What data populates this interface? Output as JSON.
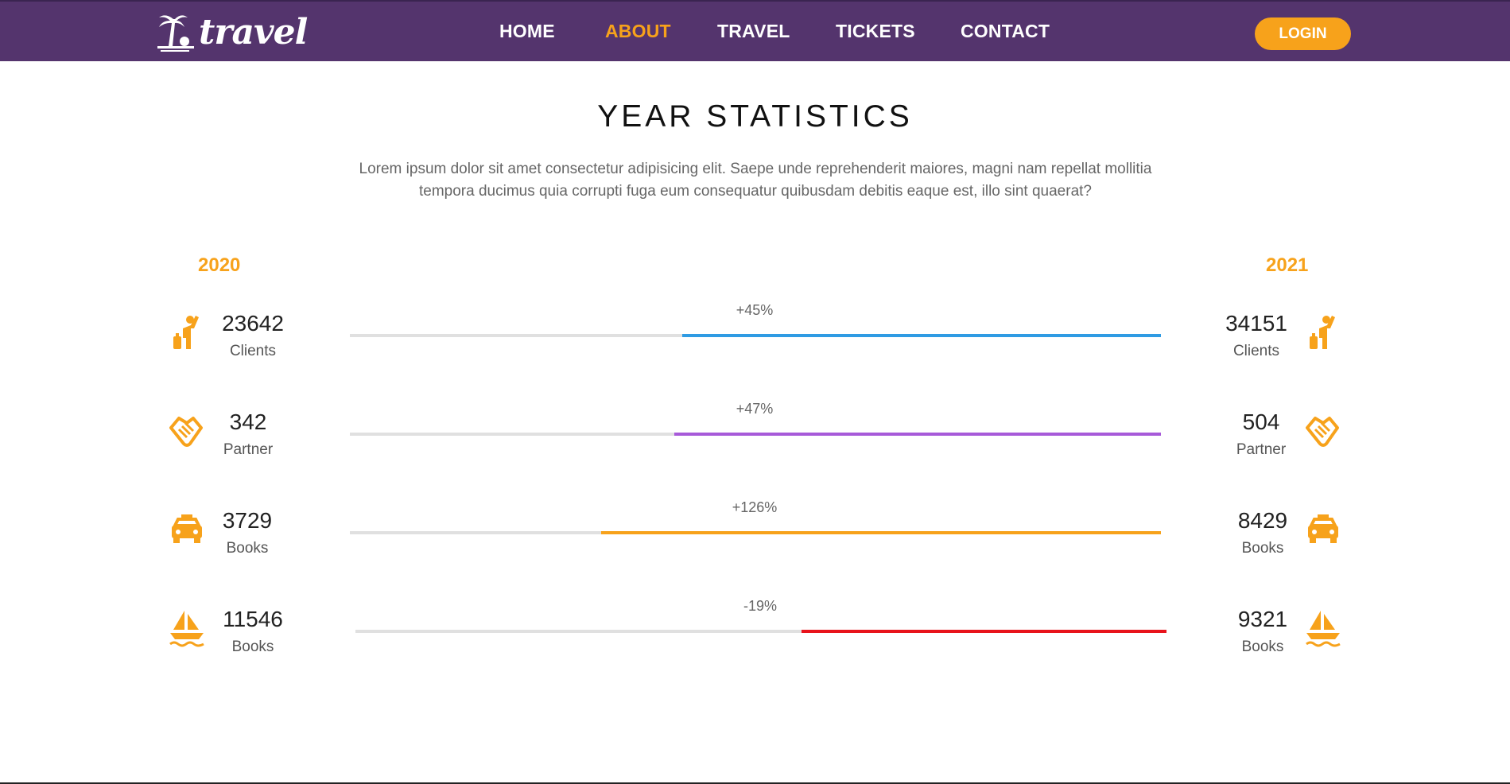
{
  "header": {
    "logo_text": "travel",
    "nav": [
      {
        "label": "HOME",
        "active": false
      },
      {
        "label": "ABOUT",
        "active": true
      },
      {
        "label": "TRAVEL",
        "active": false
      },
      {
        "label": "TICKETS",
        "active": false
      },
      {
        "label": "CONTACT",
        "active": false
      }
    ],
    "login_label": "LOGIN"
  },
  "section": {
    "title": "YEAR STATISTICS",
    "description_line1": "Lorem ipsum dolor sit amet consectetur adipisicing elit. Saepe unde reprehenderit maiores, magni nam repellat mollitia",
    "description_line2": "tempora ducimus quia corrupti fuga eum consequatur quibusdam debitis eaque est, illo sint quaerat?",
    "year_left": "2020",
    "year_right": "2021"
  },
  "stats": [
    {
      "icon": "person-waving-icon",
      "left_value": "23642",
      "left_label": "Clients",
      "right_value": "34151",
      "right_label": "Clients",
      "change": "+45%",
      "fill_fraction": 0.59,
      "color": "#2f9be3"
    },
    {
      "icon": "handshake-icon",
      "left_value": "342",
      "left_label": "Partner",
      "right_value": "504",
      "right_label": "Partner",
      "change": "+47%",
      "fill_fraction": 0.6,
      "color": "#a75ad9"
    },
    {
      "icon": "taxi-icon",
      "left_value": "3729",
      "left_label": "Books",
      "right_value": "8429",
      "right_label": "Books",
      "change": "+126%",
      "fill_fraction": 0.69,
      "color": "#f7a21b"
    },
    {
      "icon": "sailboat-icon",
      "left_value": "11546",
      "left_label": "Books",
      "right_value": "9321",
      "right_label": "Books",
      "change": "-19%",
      "fill_fraction": 0.45,
      "color": "#e8131b"
    }
  ],
  "colors": {
    "header_bg": "#54346d",
    "accent": "#f7a21b",
    "track": "#e0e0e0"
  }
}
